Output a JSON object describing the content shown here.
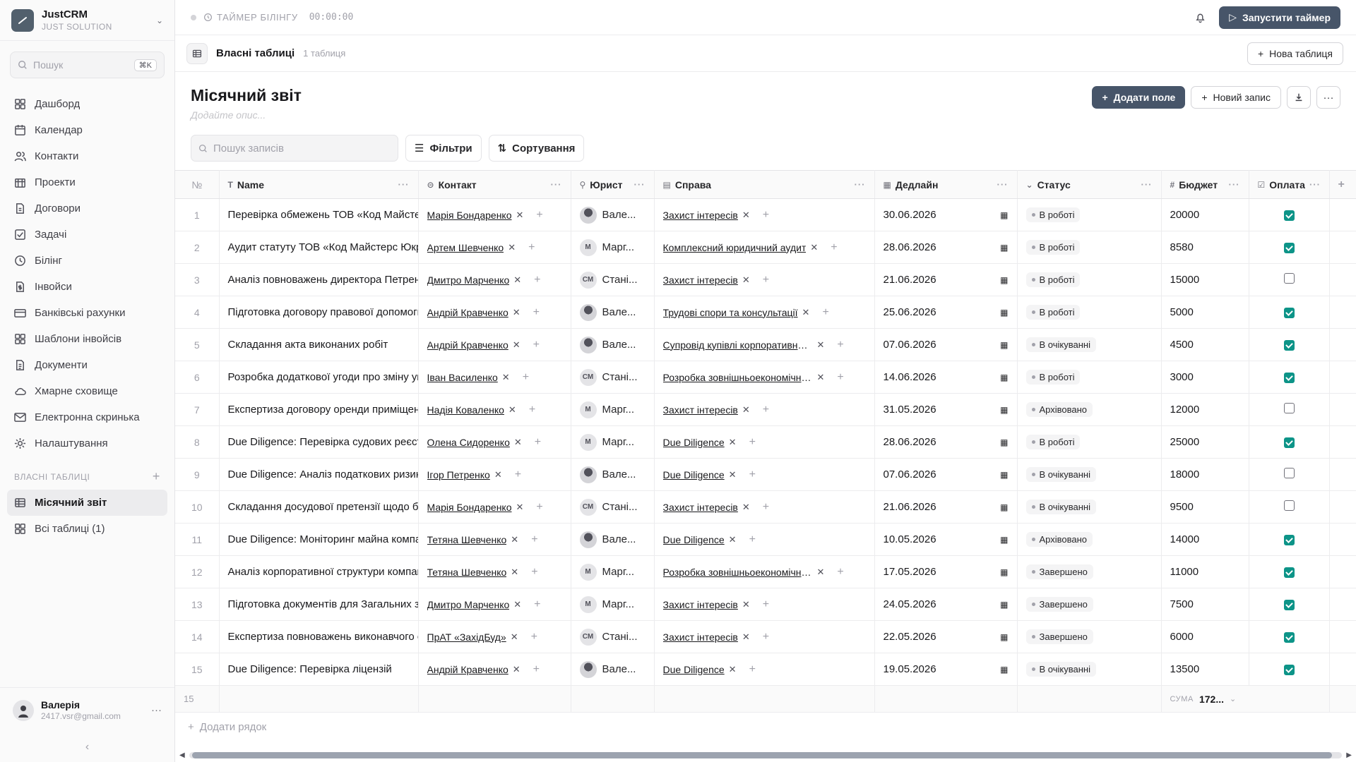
{
  "brand": {
    "name": "JustCRM",
    "sub": "JUST SOLUTION"
  },
  "search": {
    "placeholder": "Пошук",
    "shortcut": "⌘K"
  },
  "nav": [
    {
      "label": "Дашборд",
      "icon": "grid-icon"
    },
    {
      "label": "Календар",
      "icon": "calendar-icon"
    },
    {
      "label": "Контакти",
      "icon": "users-icon"
    },
    {
      "label": "Проекти",
      "icon": "building-icon"
    },
    {
      "label": "Договори",
      "icon": "file-icon"
    },
    {
      "label": "Задачі",
      "icon": "check-square-icon"
    },
    {
      "label": "Білінг",
      "icon": "clock-icon"
    },
    {
      "label": "Інвойси",
      "icon": "dollar-file-icon"
    },
    {
      "label": "Банківські рахунки",
      "icon": "card-icon"
    },
    {
      "label": "Шаблони інвойсів",
      "icon": "template-icon"
    },
    {
      "label": "Документи",
      "icon": "doc-icon"
    },
    {
      "label": "Хмарне сховище",
      "icon": "cloud-icon"
    },
    {
      "label": "Електронна скринька",
      "icon": "mail-icon"
    },
    {
      "label": "Налаштування",
      "icon": "gear-icon"
    }
  ],
  "custom_tables": {
    "label": "ВЛАСНІ ТАБЛИЦІ",
    "items": [
      "Місячний звіт",
      "Всі таблиці (1)"
    ]
  },
  "user": {
    "name": "Валерія",
    "email": "2417.vsr@gmail.com"
  },
  "topbar": {
    "timer_label": "ТАЙМЕР БІЛІНГУ",
    "timer_value": "00:00:00",
    "start_timer": "Запустити таймер"
  },
  "subbar": {
    "title": "Власні таблиці",
    "count": "1 таблиця",
    "new_table": "Нова таблиця"
  },
  "page": {
    "title": "Місячний звіт",
    "description_placeholder": "Додайте опис...",
    "add_field": "Додати поле",
    "new_record": "Новий запис"
  },
  "toolbar": {
    "search_placeholder": "Пошук записів",
    "filters": "Фільтри",
    "sort": "Сортування"
  },
  "columns": [
    "№",
    "Name",
    "Контакт",
    "Юрист",
    "Справа",
    "Дедлайн",
    "Статус",
    "Бюджет",
    "Оплата"
  ],
  "rows": [
    {
      "n": "1",
      "name": "Перевірка обмежень ТОВ «Код Майстерс Юкрейн»",
      "contact": "Марія Бондаренко",
      "lawyer": "Вале...",
      "lawyer_av": "photo",
      "case": "Захист інтересів",
      "deadline": "30.06.2026",
      "status": "В роботі",
      "budget": "20000",
      "paid": true
    },
    {
      "n": "2",
      "name": "Аудит статуту ТОВ «Код Майстерс Юкрейн»",
      "contact": "Артем Шевченко",
      "lawyer": "Марг...",
      "lawyer_av": "М",
      "case": "Комплексний юридичний аудит",
      "deadline": "28.06.2026",
      "status": "В роботі",
      "budget": "8580",
      "paid": true
    },
    {
      "n": "3",
      "name": "Аналіз повноважень директора Петренка",
      "contact": "Дмитро Марченко",
      "lawyer": "Стані...",
      "lawyer_av": "СМ",
      "case": "Захист інтересів",
      "deadline": "21.06.2026",
      "status": "В роботі",
      "budget": "15000",
      "paid": false
    },
    {
      "n": "4",
      "name": "Підготовка договору правової допомоги",
      "contact": "Андрій Кравченко",
      "lawyer": "Вале...",
      "lawyer_av": "photo",
      "case": "Трудові спори та консультації",
      "deadline": "25.06.2026",
      "status": "В роботі",
      "budget": "5000",
      "paid": true
    },
    {
      "n": "5",
      "name": "Складання акта виконаних робіт",
      "contact": "Андрій Кравченко",
      "lawyer": "Вале...",
      "lawyer_av": "photo",
      "case": "Супровід купівлі корпоративних прав",
      "deadline": "07.06.2026",
      "status": "В очікуванні",
      "budget": "4500",
      "paid": true
    },
    {
      "n": "6",
      "name": "Розробка додаткової угоди про зміну умов",
      "contact": "Іван Василенко",
      "lawyer": "Стані...",
      "lawyer_av": "СМ",
      "case": "Розробка зовнішньоекономічного контракту",
      "deadline": "14.06.2026",
      "status": "В роботі",
      "budget": "3000",
      "paid": true
    },
    {
      "n": "7",
      "name": "Експертиза договору оренди приміщення",
      "contact": "Надія Коваленко",
      "lawyer": "Марг...",
      "lawyer_av": "М",
      "case": "Захист інтересів",
      "deadline": "31.05.2026",
      "status": "Архівовано",
      "budget": "12000",
      "paid": false
    },
    {
      "n": "8",
      "name": "Due Diligence: Перевірка судових реєстрів",
      "contact": "Олена Сидоренко",
      "lawyer": "Марг...",
      "lawyer_av": "М",
      "case": "Due Diligence",
      "deadline": "28.06.2026",
      "status": "В роботі",
      "budget": "25000",
      "paid": true
    },
    {
      "n": "9",
      "name": "Due Diligence: Аналіз податкових ризиків",
      "contact": "Ігор Петренко",
      "lawyer": "Вале...",
      "lawyer_av": "photo",
      "case": "Due Diligence",
      "deadline": "07.06.2026",
      "status": "В очікуванні",
      "budget": "18000",
      "paid": false
    },
    {
      "n": "10",
      "name": "Складання досудової претензії щодо боргу",
      "contact": "Марія Бондаренко",
      "lawyer": "Стані...",
      "lawyer_av": "СМ",
      "case": "Захист інтересів",
      "deadline": "21.06.2026",
      "status": "В очікуванні",
      "budget": "9500",
      "paid": false
    },
    {
      "n": "11",
      "name": "Due Diligence: Моніторинг майна компанії",
      "contact": "Тетяна Шевченко",
      "lawyer": "Вале...",
      "lawyer_av": "photo",
      "case": "Due Diligence",
      "deadline": "10.05.2026",
      "status": "Архівовано",
      "budget": "14000",
      "paid": true
    },
    {
      "n": "12",
      "name": "Аналіз корпоративної структури компанії",
      "contact": "Тетяна Шевченко",
      "lawyer": "Марг...",
      "lawyer_av": "М",
      "case": "Розробка зовнішньоекономічного контракту",
      "deadline": "17.05.2026",
      "status": "Завершено",
      "budget": "11000",
      "paid": true
    },
    {
      "n": "13",
      "name": "Підготовка документів для Загальних зборів",
      "contact": "Дмитро Марченко",
      "lawyer": "Марг...",
      "lawyer_av": "М",
      "case": "Захист інтересів",
      "deadline": "24.05.2026",
      "status": "Завершено",
      "budget": "7500",
      "paid": true
    },
    {
      "n": "14",
      "name": "Експертиза повноважень виконавчого органу",
      "contact": "ПрАТ «ЗахідБуд»",
      "lawyer": "Стані...",
      "lawyer_av": "СМ",
      "case": "Захист інтересів",
      "deadline": "22.05.2026",
      "status": "Завершено",
      "budget": "6000",
      "paid": true
    },
    {
      "n": "15",
      "name": "Due Diligence: Перевірка ліцензій",
      "contact": "Андрій Кравченко",
      "lawyer": "Вале...",
      "lawyer_av": "photo",
      "case": "Due Diligence",
      "deadline": "19.05.2026",
      "status": "В очікуванні",
      "budget": "13500",
      "paid": true
    }
  ],
  "footer": {
    "count": "15",
    "sum_label": "СУМА",
    "sum_value": "172..."
  },
  "add_row": "Додати рядок"
}
